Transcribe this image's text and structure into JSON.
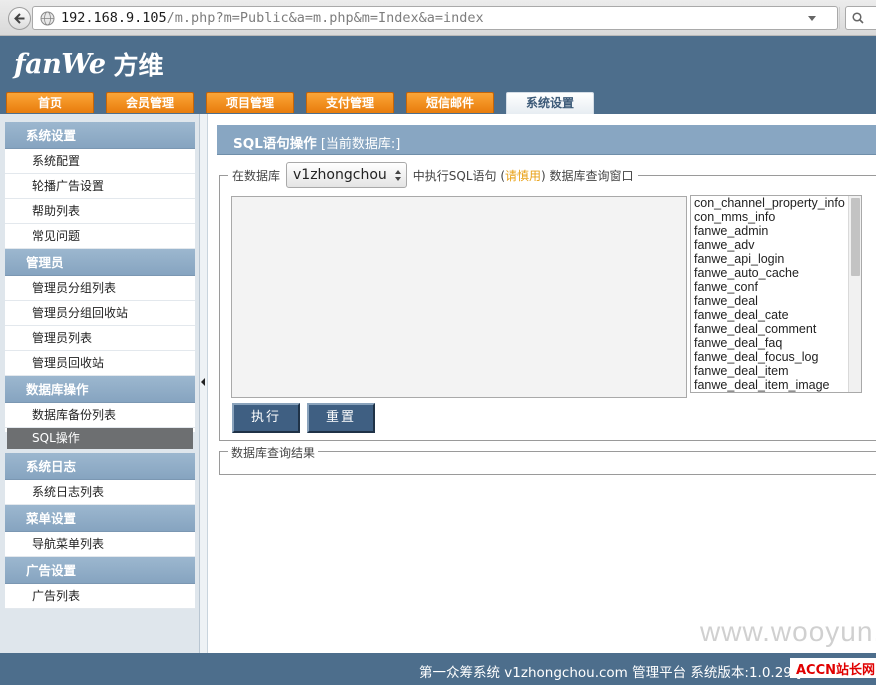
{
  "browser": {
    "url_host": "192.168.9.105",
    "url_path": "/m.php?m=Public&a=m.php&m=Index&a=index",
    "search_placeholder": "S"
  },
  "header": {
    "logo_en": "fanWe",
    "logo_cn": "方维",
    "tabs": [
      {
        "label": "首页"
      },
      {
        "label": "会员管理"
      },
      {
        "label": "项目管理"
      },
      {
        "label": "支付管理"
      },
      {
        "label": "短信邮件"
      },
      {
        "label": "系统设置",
        "active": true
      }
    ]
  },
  "sidebar": {
    "sections": [
      {
        "title": "系统设置",
        "items": [
          "系统配置",
          "轮播广告设置",
          "帮助列表",
          "常见问题"
        ]
      },
      {
        "title": "管理员",
        "items": [
          "管理员分组列表",
          "管理员分组回收站",
          "管理员列表",
          "管理员回收站"
        ]
      },
      {
        "title": "数据库操作",
        "items": [
          "数据库备份列表",
          "SQL操作"
        ]
      },
      {
        "title": "系统日志",
        "items": [
          "系统日志列表"
        ]
      },
      {
        "title": "菜单设置",
        "items": [
          "导航菜单列表"
        ]
      },
      {
        "title": "广告设置",
        "items": [
          "广告列表"
        ]
      }
    ],
    "active_item": "SQL操作"
  },
  "main": {
    "title": "SQL语句操作",
    "subtitle": "[当前数据库:]",
    "query_legend_pre": "在数据库",
    "database_selected": "v1zhongchou",
    "query_legend_mid": "中执行SQL语句 (",
    "query_legend_warn": "请慎用",
    "query_legend_post": ") 数据库查询窗口",
    "sql_text": "",
    "tables": [
      "con_channel_property_info",
      "con_mms_info",
      "fanwe_admin",
      "fanwe_adv",
      "fanwe_api_login",
      "fanwe_auto_cache",
      "fanwe_conf",
      "fanwe_deal",
      "fanwe_deal_cate",
      "fanwe_deal_comment",
      "fanwe_deal_faq",
      "fanwe_deal_focus_log",
      "fanwe_deal_item",
      "fanwe_deal_item_image"
    ],
    "execute_label": "执行",
    "reset_label": "重置",
    "result_legend": "数据库查询结果"
  },
  "footer": {
    "text": "第一众筹系统 v1zhongchou.com 管理平台 系统版本:1.0.29 ["
  },
  "watermark": {
    "site": "www.wooyun.org",
    "tag": "ACCN站长网"
  },
  "colors": {
    "header_bg": "#4d6e8c",
    "tab_orange": "#f39423",
    "sidebar_head": "#8fabc6",
    "button_bg": "#3f5f82",
    "warn": "#e8a014"
  }
}
